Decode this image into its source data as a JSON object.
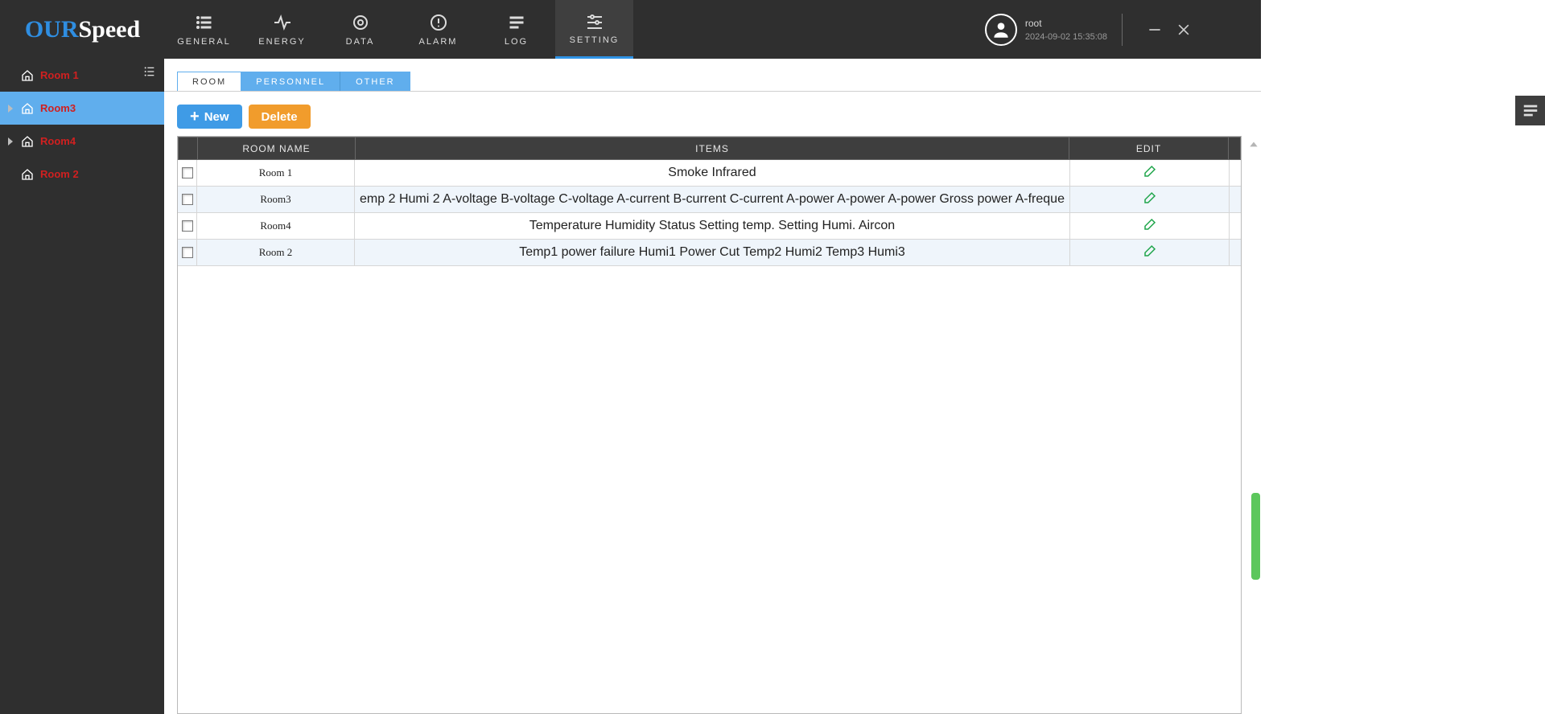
{
  "logo": {
    "part1": "OUR",
    "part2": "Speed"
  },
  "nav": {
    "items": [
      {
        "label": "GENERAL"
      },
      {
        "label": "ENERGY"
      },
      {
        "label": "DATA"
      },
      {
        "label": "ALARM"
      },
      {
        "label": "LOG"
      },
      {
        "label": "SETTING"
      }
    ]
  },
  "user": {
    "name": "root",
    "time": "2024-09-02 15:35:08"
  },
  "sidebar": {
    "items": [
      {
        "label": "Room 1",
        "expandable": false
      },
      {
        "label": "Room3",
        "expandable": true,
        "active": true
      },
      {
        "label": "Room4",
        "expandable": true
      },
      {
        "label": "Room 2",
        "expandable": false
      }
    ]
  },
  "tabs": {
    "room": "ROOM",
    "personnel": "PERSONNEL",
    "other": "OTHER"
  },
  "buttons": {
    "new": "New",
    "delete": "Delete"
  },
  "table": {
    "headers": {
      "room": "ROOM NAME",
      "items": "ITEMS",
      "edit": "EDIT"
    },
    "rows": [
      {
        "room": "Room 1",
        "items": "Smoke Infrared"
      },
      {
        "room": "Room3",
        "items": "emp 2 Humi 2 A-voltage B-voltage C-voltage A-current B-current C-current A-power A-power A-power Gross power A-freque"
      },
      {
        "room": "Room4",
        "items": "Temperature Humidity Status Setting temp. Setting Humi. Aircon"
      },
      {
        "room": "Room 2",
        "items": "Temp1 power failure Humi1 Power Cut  Temp2 Humi2 Temp3 Humi3"
      }
    ]
  }
}
